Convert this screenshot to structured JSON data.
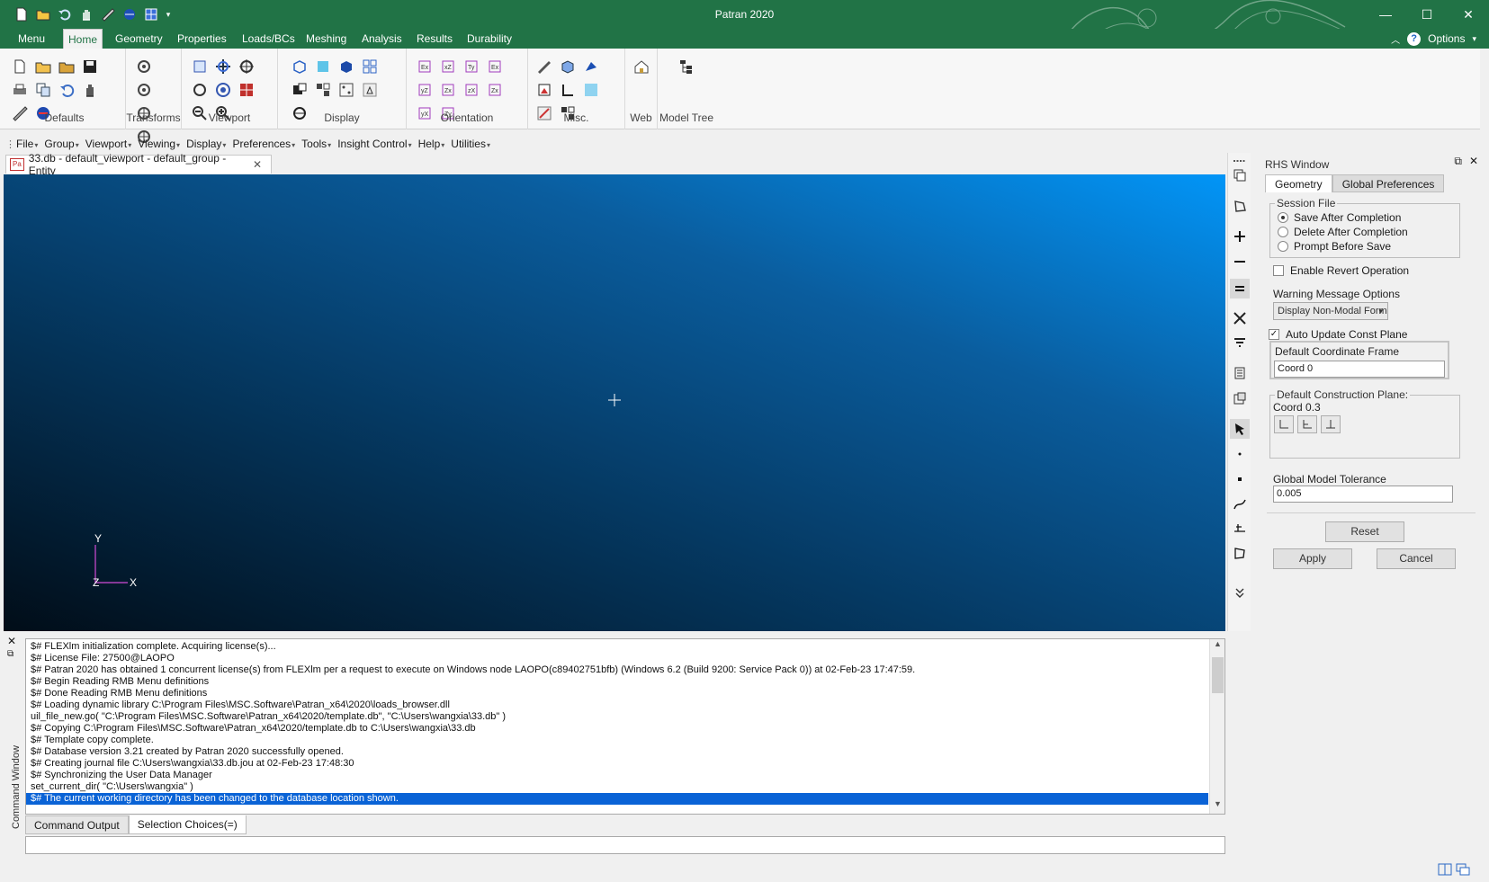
{
  "window": {
    "title": "Patran 2020",
    "controls": [
      "—",
      "☐",
      "✕"
    ]
  },
  "ribbon_tabs": {
    "menu": "Menu",
    "items": [
      "Home",
      "Geometry",
      "Properties",
      "Loads/BCs",
      "Meshing",
      "Analysis",
      "Results",
      "Durability"
    ],
    "active": "Home",
    "options": "Options"
  },
  "ribbon_groups": [
    "Defaults",
    "Transforms",
    "Viewport",
    "Display",
    "Orientation",
    "Misc.",
    "Web",
    "Model Tree"
  ],
  "menubar": [
    "File",
    "Group",
    "Viewport",
    "Viewing",
    "Display",
    "Preferences",
    "Tools",
    "Insight Control",
    "Help",
    "Utilities"
  ],
  "doc_tab": {
    "icon": "Pa",
    "label": "33.db - default_viewport - default_group - Entity"
  },
  "viewport_axes": {
    "x": "X",
    "y": "Y",
    "z": "Z"
  },
  "rhs": {
    "title": "RHS Window",
    "tabs": [
      "Geometry",
      "Global Preferences"
    ],
    "session_file": {
      "title": "Session File",
      "options": [
        "Save After Completion",
        "Delete After Completion",
        "Prompt Before Save"
      ],
      "selected": "Save After Completion"
    },
    "enable_revert": {
      "label": "Enable Revert Operation",
      "checked": false
    },
    "warning_label": "Warning Message Options",
    "warning_value": "Display Non-Modal Form",
    "auto_update": {
      "label": "Auto Update Const Plane",
      "checked": true
    },
    "coord_frame_label": "Default Coordinate Frame",
    "coord_frame_value": "Coord 0",
    "construction_plane_label": "Default Construction Plane:",
    "construction_plane_value": "Coord 0.3",
    "tolerance_label": "Global Model Tolerance",
    "tolerance_value": "0.005",
    "reset": "Reset",
    "apply": "Apply",
    "cancel": "Cancel"
  },
  "command_window": {
    "side_label": "Command Window",
    "lines": [
      "$# FLEXlm initialization complete.  Acquiring license(s)...",
      "$# License File: 27500@LAOPO",
      "$# Patran 2020 has obtained 1 concurrent license(s) from FLEXlm per a request to execute on Windows node LAOPO(c89402751bfb) (Windows 6.2 (Build 9200: Service Pack 0)) at 02-Feb-23 17:47:59.",
      "$# Begin Reading RMB Menu definitions",
      "$# Done Reading RMB Menu definitions",
      "$# Loading dynamic library C:\\Program Files\\MSC.Software\\Patran_x64\\2020\\loads_browser.dll",
      "uil_file_new.go( \"C:\\Program Files\\MSC.Software\\Patran_x64\\2020/template.db\", \"C:\\Users\\wangxia\\33.db\" )",
      "$# Copying C:\\Program Files\\MSC.Software\\Patran_x64\\2020/template.db to C:\\Users\\wangxia\\33.db",
      "$# Template copy complete.",
      "$# Database version 3.21 created by Patran 2020 successfully opened.",
      "$# Creating journal file C:\\Users\\wangxia\\33.db.jou at 02-Feb-23 17:48:30",
      "$# Synchronizing the User Data Manager",
      "set_current_dir( \"C:\\Users\\wangxia\" )",
      "$# The current working directory has been changed to the database location shown."
    ],
    "tabs": [
      "Command Output",
      "Selection Choices(=)"
    ]
  },
  "colors": {
    "brand_green": "#217346",
    "selection_blue": "#0a63d6"
  }
}
